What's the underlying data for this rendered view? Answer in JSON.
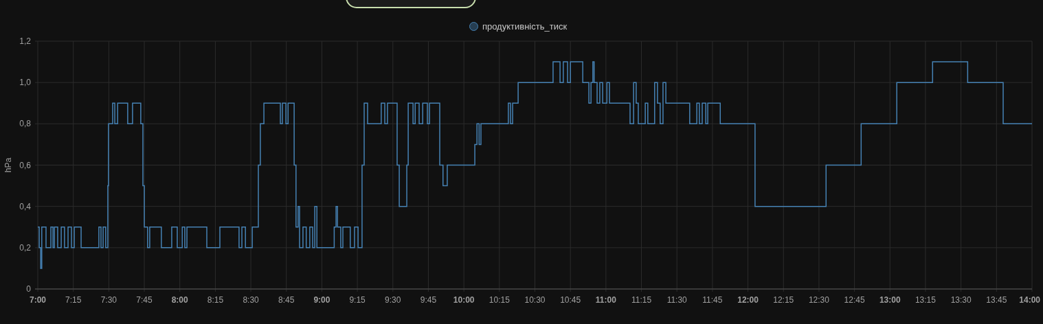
{
  "chart_data": {
    "type": "line",
    "ylabel": "hPa",
    "grid": true,
    "xlim": [
      7,
      14
    ],
    "ylim": [
      0,
      1.2
    ],
    "yticks": [
      {
        "value": 0,
        "label": "0"
      },
      {
        "value": 0.2,
        "label": "0,2"
      },
      {
        "value": 0.4,
        "label": "0,4"
      },
      {
        "value": 0.6,
        "label": "0,6"
      },
      {
        "value": 0.8,
        "label": "0,8"
      },
      {
        "value": 1,
        "label": "1,0"
      },
      {
        "value": 1.2,
        "label": "1,2"
      }
    ],
    "xticks": [
      {
        "value": 7,
        "label": "7:00"
      },
      {
        "value": 7.25,
        "label": "7:15"
      },
      {
        "value": 7.5,
        "label": "7:30"
      },
      {
        "value": 7.75,
        "label": "7:45"
      },
      {
        "value": 8,
        "label": "8:00"
      },
      {
        "value": 8.25,
        "label": "8:15"
      },
      {
        "value": 8.5,
        "label": "8:30"
      },
      {
        "value": 8.75,
        "label": "8:45"
      },
      {
        "value": 9,
        "label": "9:00"
      },
      {
        "value": 9.25,
        "label": "9:15"
      },
      {
        "value": 9.5,
        "label": "9:30"
      },
      {
        "value": 9.75,
        "label": "9:45"
      },
      {
        "value": 10,
        "label": "10:00"
      },
      {
        "value": 10.25,
        "label": "10:15"
      },
      {
        "value": 10.5,
        "label": "10:30"
      },
      {
        "value": 10.75,
        "label": "10:45"
      },
      {
        "value": 11,
        "label": "11:00"
      },
      {
        "value": 11.25,
        "label": "11:15"
      },
      {
        "value": 11.5,
        "label": "11:30"
      },
      {
        "value": 11.75,
        "label": "11:45"
      },
      {
        "value": 12,
        "label": "12:00"
      },
      {
        "value": 12.25,
        "label": "12:15"
      },
      {
        "value": 12.5,
        "label": "12:30"
      },
      {
        "value": 12.75,
        "label": "12:45"
      },
      {
        "value": 13,
        "label": "13:00"
      },
      {
        "value": 13.25,
        "label": "13:15"
      },
      {
        "value": 13.5,
        "label": "13:30"
      },
      {
        "value": 13.75,
        "label": "13:45"
      },
      {
        "value": 14,
        "label": "14:00"
      }
    ],
    "x": [
      7,
      7.01,
      7.01,
      7.02,
      7.02,
      7.028,
      7.028,
      7.058,
      7.058,
      7.092,
      7.092,
      7.107,
      7.107,
      7.117,
      7.117,
      7.14,
      7.14,
      7.165,
      7.165,
      7.188,
      7.188,
      7.213,
      7.213,
      7.237,
      7.237,
      7.257,
      7.257,
      7.305,
      7.305,
      7.43,
      7.43,
      7.445,
      7.445,
      7.46,
      7.46,
      7.478,
      7.478,
      7.493,
      7.493,
      7.498,
      7.498,
      7.527,
      7.527,
      7.542,
      7.542,
      7.562,
      7.562,
      7.633,
      7.633,
      7.667,
      7.667,
      7.725,
      7.725,
      7.74,
      7.74,
      7.75,
      7.75,
      7.773,
      7.773,
      7.788,
      7.788,
      7.87,
      7.87,
      7.943,
      7.943,
      7.982,
      7.982,
      8.017,
      8.017,
      8.035,
      8.035,
      8.05,
      8.05,
      8.19,
      8.19,
      8.282,
      8.282,
      8.417,
      8.417,
      8.437,
      8.437,
      8.462,
      8.462,
      8.51,
      8.51,
      8.553,
      8.553,
      8.567,
      8.567,
      8.592,
      8.592,
      8.708,
      8.708,
      8.722,
      8.722,
      8.747,
      8.747,
      8.762,
      8.762,
      8.805,
      8.805,
      8.818,
      8.818,
      8.833,
      8.833,
      8.843,
      8.843,
      8.867,
      8.867,
      8.89,
      8.89,
      8.915,
      8.915,
      8.935,
      8.935,
      8.95,
      8.95,
      8.965,
      8.965,
      9.087,
      9.087,
      9.1,
      9.1,
      9.11,
      9.11,
      9.133,
      9.133,
      9.148,
      9.148,
      9.2,
      9.2,
      9.23,
      9.23,
      9.255,
      9.255,
      9.283,
      9.283,
      9.298,
      9.298,
      9.322,
      9.322,
      9.418,
      9.418,
      9.443,
      9.443,
      9.462,
      9.462,
      9.53,
      9.53,
      9.545,
      9.545,
      9.598,
      9.598,
      9.608,
      9.608,
      9.642,
      9.642,
      9.657,
      9.657,
      9.685,
      9.685,
      9.71,
      9.71,
      9.743,
      9.743,
      9.758,
      9.758,
      9.83,
      9.83,
      9.853,
      9.853,
      9.883,
      9.883,
      10.077,
      10.077,
      10.092,
      10.092,
      10.107,
      10.107,
      10.12,
      10.12,
      10.313,
      10.313,
      10.328,
      10.328,
      10.343,
      10.343,
      10.382,
      10.382,
      10.628,
      10.628,
      10.677,
      10.677,
      10.7,
      10.7,
      10.73,
      10.73,
      10.75,
      10.75,
      10.837,
      10.837,
      10.88,
      10.88,
      10.895,
      10.895,
      10.908,
      10.908,
      10.917,
      10.917,
      10.938,
      10.938,
      10.957,
      10.957,
      10.977,
      10.977,
      11.007,
      11.007,
      11.025,
      11.025,
      11.17,
      11.17,
      11.195,
      11.195,
      11.213,
      11.213,
      11.228,
      11.228,
      11.277,
      11.277,
      11.295,
      11.295,
      11.343,
      11.343,
      11.363,
      11.363,
      11.382,
      11.382,
      11.402,
      11.402,
      11.422,
      11.422,
      11.59,
      11.59,
      11.64,
      11.64,
      11.658,
      11.658,
      11.678,
      11.678,
      11.703,
      11.703,
      11.717,
      11.717,
      11.805,
      11.805,
      12.05,
      12.05,
      12.55,
      12.55,
      12.797,
      12.797,
      13.048,
      13.048,
      13.3,
      13.3,
      13.547,
      13.547,
      13.797,
      13.797,
      14
    ],
    "series": [
      {
        "name": "продуктивність_тиск",
        "color": "#4682b4",
        "values": [
          0.3,
          0.3,
          0.2,
          0.2,
          0.1,
          0.1,
          0.3,
          0.3,
          0.2,
          0.2,
          0.3,
          0.3,
          0.2,
          0.2,
          0.3,
          0.3,
          0.2,
          0.2,
          0.3,
          0.3,
          0.2,
          0.2,
          0.3,
          0.3,
          0.2,
          0.2,
          0.3,
          0.3,
          0.2,
          0.2,
          0.3,
          0.3,
          0.2,
          0.2,
          0.3,
          0.3,
          0.2,
          0.2,
          0.5,
          0.5,
          0.8,
          0.8,
          0.9,
          0.9,
          0.8,
          0.8,
          0.9,
          0.9,
          0.8,
          0.8,
          0.9,
          0.9,
          0.8,
          0.8,
          0.5,
          0.5,
          0.3,
          0.3,
          0.2,
          0.2,
          0.3,
          0.3,
          0.2,
          0.2,
          0.3,
          0.3,
          0.2,
          0.2,
          0.3,
          0.3,
          0.2,
          0.2,
          0.3,
          0.3,
          0.2,
          0.2,
          0.3,
          0.3,
          0.2,
          0.2,
          0.3,
          0.3,
          0.2,
          0.2,
          0.3,
          0.3,
          0.6,
          0.6,
          0.8,
          0.8,
          0.9,
          0.9,
          0.8,
          0.8,
          0.9,
          0.9,
          0.8,
          0.8,
          0.9,
          0.9,
          0.6,
          0.6,
          0.3,
          0.3,
          0.4,
          0.4,
          0.2,
          0.2,
          0.3,
          0.3,
          0.2,
          0.2,
          0.3,
          0.3,
          0.2,
          0.2,
          0.4,
          0.4,
          0.2,
          0.2,
          0.3,
          0.3,
          0.4,
          0.4,
          0.3,
          0.3,
          0.2,
          0.2,
          0.3,
          0.3,
          0.2,
          0.2,
          0.3,
          0.3,
          0.2,
          0.2,
          0.6,
          0.6,
          0.9,
          0.9,
          0.8,
          0.8,
          0.9,
          0.9,
          0.8,
          0.8,
          0.9,
          0.9,
          0.6,
          0.6,
          0.4,
          0.4,
          0.6,
          0.6,
          0.9,
          0.9,
          0.8,
          0.8,
          0.9,
          0.9,
          0.8,
          0.8,
          0.9,
          0.9,
          0.8,
          0.8,
          0.9,
          0.9,
          0.6,
          0.6,
          0.5,
          0.5,
          0.6,
          0.6,
          0.7,
          0.7,
          0.8,
          0.8,
          0.7,
          0.7,
          0.8,
          0.8,
          0.9,
          0.9,
          0.8,
          0.8,
          0.9,
          0.9,
          1.0,
          1.0,
          1.1,
          1.1,
          1.0,
          1.0,
          1.1,
          1.1,
          1.0,
          1.0,
          1.1,
          1.1,
          1.0,
          1.0,
          0.9,
          0.9,
          1.0,
          1.0,
          1.1,
          1.1,
          1.0,
          1.0,
          0.9,
          0.9,
          1.0,
          1.0,
          0.9,
          0.9,
          1.0,
          1.0,
          0.9,
          0.9,
          0.8,
          0.8,
          1.0,
          1.0,
          0.9,
          0.9,
          0.8,
          0.8,
          0.9,
          0.9,
          0.8,
          0.8,
          1.0,
          1.0,
          0.9,
          0.9,
          0.8,
          0.8,
          1.0,
          1.0,
          0.9,
          0.9,
          0.8,
          0.8,
          0.9,
          0.9,
          0.8,
          0.8,
          0.9,
          0.9,
          0.8,
          0.8,
          0.9,
          0.9,
          0.8,
          0.8,
          0.4,
          0.4,
          0.6,
          0.6,
          0.8,
          0.8,
          1.0,
          1.0,
          1.1,
          1.1,
          1.0,
          1.0,
          0.8,
          0.8
        ]
      }
    ]
  }
}
